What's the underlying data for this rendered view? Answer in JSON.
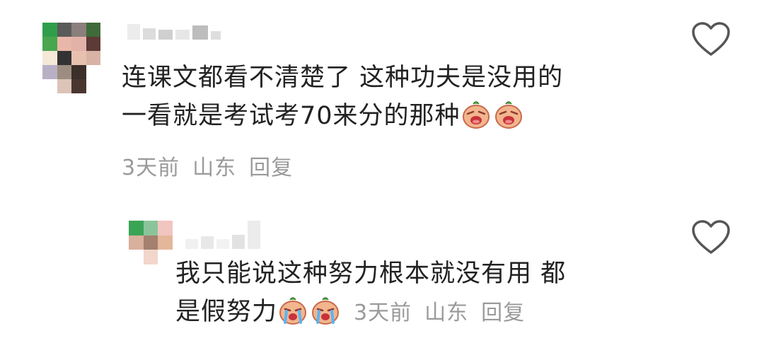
{
  "comments": [
    {
      "text_line1": "连课文都看不清楚了 这种功夫是没用的",
      "text_line2": "一看就是考试考70来分的那种",
      "emoji": [
        "crying-face-emoji",
        "crying-face-emoji"
      ],
      "time": "3天前",
      "location": "山东",
      "reply_label": "回复"
    },
    {
      "text_line1": "我只能说这种努力根本就没有用 都",
      "text_line2": "是假努力",
      "emoji": [
        "wailing-face-emoji",
        "wailing-face-emoji"
      ],
      "time": "3天前",
      "location": "山东",
      "reply_label": "回复"
    }
  ],
  "colors": {
    "text": "#222222",
    "meta": "#9a9a9a",
    "icon": "#555555"
  }
}
